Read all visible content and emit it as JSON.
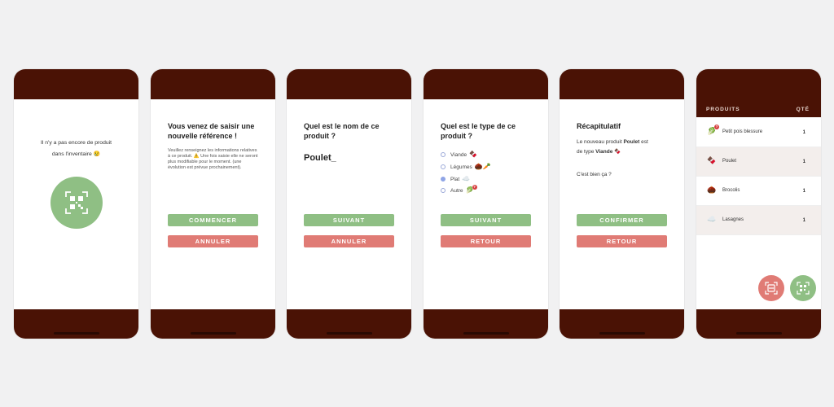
{
  "screen1": {
    "message_line1": "Il n'y a pas encore de produit",
    "message_line2": "dans l'inventaire 😢",
    "scan_icon": "qr-code-icon"
  },
  "screen2": {
    "title": "Vous venez de saisir une nouvelle référence !",
    "info": "Veuillez renseignez les informations relatives à ce produit. ⚠️ Une fois saisie elle ne seront plus modifiable pour le moment. (une évolution est prévue prochainement).",
    "primary_label": "COMMENCER",
    "secondary_label": "ANNULER"
  },
  "screen3": {
    "title": "Quel est le nom de ce produit ?",
    "value": "Poulet_",
    "primary_label": "SUIVANT",
    "secondary_label": "ANNULER"
  },
  "screen4": {
    "title": "Quel est le type de ce produit ?",
    "options": [
      {
        "label": "Viande",
        "emoji": "🍫",
        "selected": false
      },
      {
        "label": "Légumes",
        "emoji": "🌰🥕",
        "selected": false
      },
      {
        "label": "Plat",
        "emoji": "☁️",
        "selected": true
      },
      {
        "label": "Autre",
        "emoji": "🥬",
        "selected": false
      }
    ],
    "primary_label": "SUIVANT",
    "secondary_label": "RETOUR"
  },
  "screen5": {
    "title": "Récapitulatif",
    "line1_prefix": "Le nouveau produit ",
    "product_name": "Poulet",
    "line1_suffix": " est",
    "line2_prefix": "de type ",
    "product_type": "Viande",
    "line2_emoji": "🍫",
    "question": "C'est bien ça ?",
    "primary_label": "CONFIRMER",
    "secondary_label": "RETOUR"
  },
  "screen6": {
    "header_products": "PRODUITS",
    "header_qty": "QTÉ",
    "rows": [
      {
        "icon": "🥬",
        "name": "Petit pois blessure",
        "qty": "1"
      },
      {
        "icon": "🍫",
        "name": "Poulet",
        "qty": "1"
      },
      {
        "icon": "🌰",
        "name": "Brocolis",
        "qty": "1"
      },
      {
        "icon": "☁️",
        "name": "Lasagnes",
        "qty": "1"
      }
    ],
    "fab_left_icon": "scan-icon",
    "fab_right_icon": "qr-code-icon"
  },
  "colors": {
    "brand_dark": "#4a1205",
    "green": "#8fbf84",
    "red": "#e07b75",
    "radio": "#8fa5e6"
  }
}
